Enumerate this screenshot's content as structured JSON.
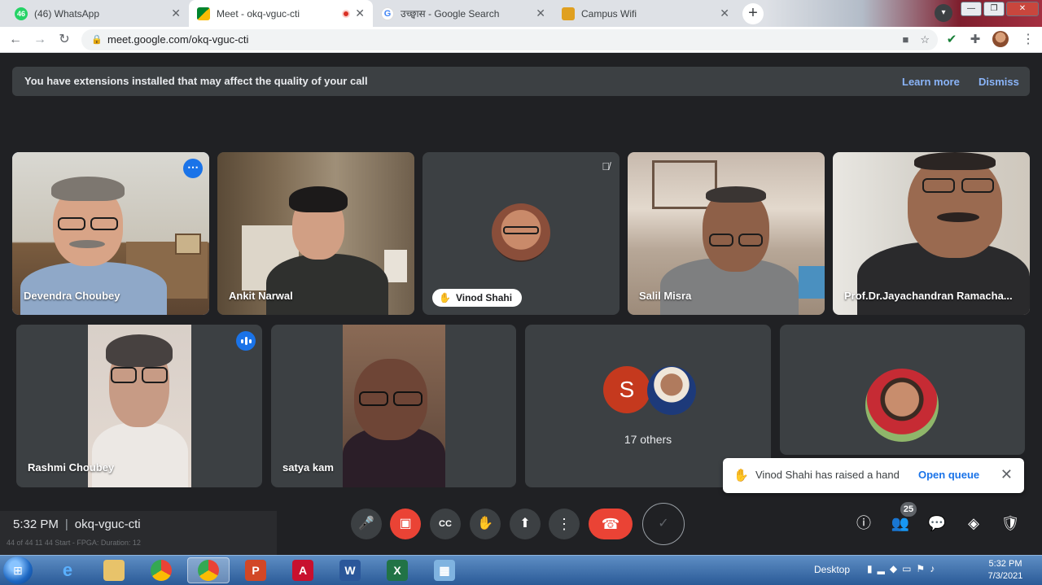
{
  "browser": {
    "tabs": [
      {
        "title": "(46) WhatsApp",
        "badge": "46"
      },
      {
        "title": "Meet - okq-vguc-cti"
      },
      {
        "title": "उच्छ्वास - Google Search"
      },
      {
        "title": "Campus Wifi"
      }
    ],
    "url": "meet.google.com/okq-vguc-cti"
  },
  "banner": {
    "message": "You have extensions installed that may affect the quality of your call",
    "learn_more": "Learn more",
    "dismiss": "Dismiss"
  },
  "participants": {
    "devendra": "Devendra Choubey",
    "ankit": "Ankit Narwal",
    "vinod": "Vinod Shahi",
    "salil": "Salil Misra",
    "jayachandran": "Prof.Dr.Jayachandran Ramacha...",
    "rashmi": "Rashmi Choubey",
    "satya": "satya kam",
    "others_letter": "S",
    "others": "17 others"
  },
  "toast": {
    "message": "Vinod Shahi has raised a hand",
    "action": "Open queue"
  },
  "meeting": {
    "time": "5:32 PM",
    "code": "okq-vguc-cti",
    "people_count": "25"
  },
  "taskbar": {
    "desktop": "Desktop",
    "time": "5:32 PM",
    "date": "7/3/2021",
    "ghost_text": "44 of 44   11   44   Start - FPGA: Duration: 12"
  },
  "colors": {
    "meet_bg": "#202124",
    "tile_bg": "#3c4043",
    "accent": "#1a73e8",
    "link": "#8ab4f8",
    "leave": "#ea4335"
  }
}
